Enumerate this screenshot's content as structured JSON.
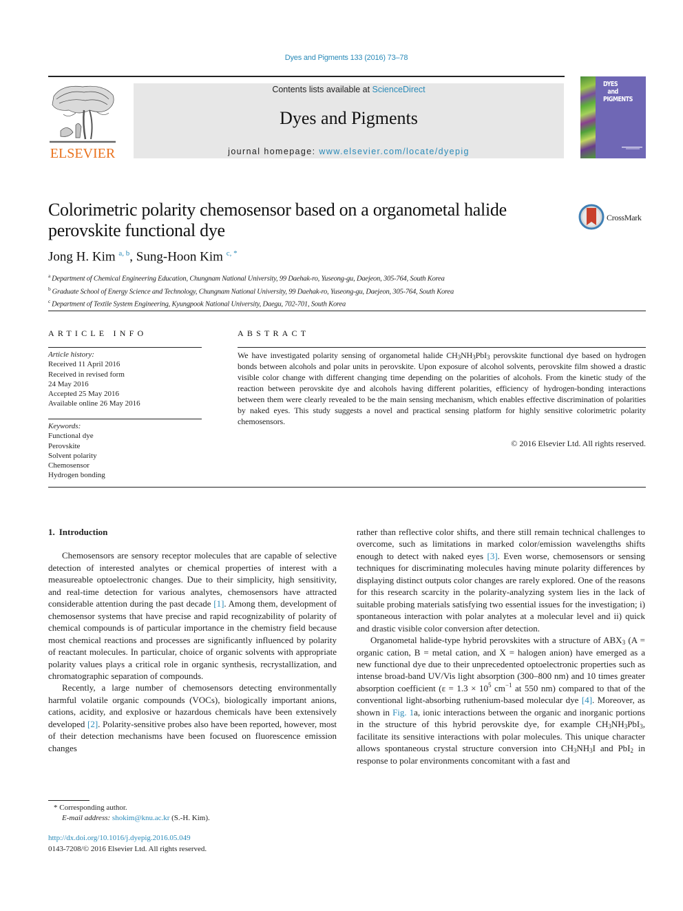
{
  "header": {
    "citation": "Dyes and Pigments 133 (2016) 73–78",
    "contents_prefix": "Contents lists available at ",
    "contents_link": "ScienceDirect",
    "journal_name": "Dyes and Pigments",
    "homepage_prefix": "journal homepage: ",
    "homepage_link": "www.elsevier.com/locate/dyepig",
    "publisher_logo_text": "ELSEVIER",
    "cover_title_lines": [
      "DYES",
      "and",
      "PIGMENTS"
    ],
    "colors": {
      "link": "#2a8ab8",
      "publisher_orange": "#e9711c",
      "banner_gray": "#e7e7e7",
      "cover_purple": "#6f67b5"
    }
  },
  "article": {
    "title_line1": "Colorimetric polarity chemosensor based on a organometal halide",
    "title_line2": "perovskite functional dye",
    "crossmark_label": "CrossMark",
    "authors": [
      {
        "name": "Jong H. Kim",
        "affil_marks": "a, b"
      },
      {
        "name": "Sung-Hoon Kim",
        "affil_marks": "c, *"
      }
    ],
    "author_separator": ", ",
    "affiliations": [
      {
        "mark": "a",
        "text": "Department of Chemical Engineering Education, Chungnam National University, 99 Daehak-ro, Yuseong-gu, Daejeon, 305-764, South Korea"
      },
      {
        "mark": "b",
        "text": "Graduate School of Energy Science and Technology, Chungnam National University, 99 Daehak-ro, Yuseong-gu, Daejeon, 305-764, South Korea"
      },
      {
        "mark": "c",
        "text": "Department of Textile System Engineering, Kyungpook National University, Daegu, 702-701, South Korea"
      }
    ]
  },
  "article_info": {
    "heading": "ARTICLE INFO",
    "history_label": "Article history:",
    "history": [
      "Received 11 April 2016",
      "Received in revised form",
      "24 May 2016",
      "Accepted 25 May 2016",
      "Available online 26 May 2016"
    ],
    "keywords_label": "Keywords:",
    "keywords": [
      "Functional dye",
      "Perovskite",
      "Solvent polarity",
      "Chemosensor",
      "Hydrogen bonding"
    ]
  },
  "abstract": {
    "heading": "ABSTRACT",
    "text_part1": "We have investigated polarity sensing of organometal halide ",
    "formula": [
      "CH",
      "3",
      "NH",
      "3",
      "PbI",
      "3"
    ],
    "text_part2": " perovskite functional dye based on hydrogen bonds between alcohols and polar units in perovskite. Upon exposure of alcohol solvents, perovskite film showed a drastic visible color change with different changing time depending on the polarities of alcohols. From the kinetic study of the reaction between perovskite dye and alcohols having different polarities, efficiency of hydrogen-bonding interactions between them were clearly revealed to be the main sensing mechanism, which enables effective discrimination of polarities by naked eyes. This study suggests a novel and practical sensing platform for highly sensitive colorimetric polarity chemosensors.",
    "copyright": "© 2016 Elsevier Ltd. All rights reserved."
  },
  "body": {
    "section_number": "1.",
    "section_title": "Introduction",
    "left_p1_a": "Chemosensors are sensory receptor molecules that are capable of selective detection of interested analytes or chemical properties of interest with a measureable optoelectronic changes. Due to their simplicity, high sensitivity, and real-time detection for various analytes, chemosensors have attracted considerable attention during the past decade ",
    "ref1": "[1]",
    "left_p1_b": ". Among them, development of chemosensor systems that have precise and rapid recognizability of polarity of chemical compounds is of particular importance in the chemistry field because most chemical reactions and processes are significantly influenced by polarity of reactant molecules. In particular, choice of organic solvents with appropriate polarity values plays a critical role in organic synthesis, recrystallization, and chromatographic separation of compounds.",
    "left_p2_a": "Recently, a large number of chemosensors detecting environmentally harmful volatile organic compounds (VOCs), biologically important anions, cations, acidity, and explosive or hazardous chemicals have been extensively developed ",
    "ref2": "[2]",
    "left_p2_b": ". Polarity-sensitive probes also have been reported, however, most of their detection mechanisms have been focused on fluorescence emission changes",
    "right_p1_a": "rather than reflective color shifts, and there still remain technical challenges to overcome, such as limitations in marked color/emission wavelengths shifts enough to detect with naked eyes ",
    "ref3": "[3]",
    "right_p1_b": ". Even worse, chemosensors or sensing techniques for discriminating molecules having minute polarity differences by displaying distinct outputs color changes are rarely explored. One of the reasons for this research scarcity in the polarity-analyzing system lies in the lack of suitable probing materials satisfying two essential issues for the investigation; i) spontaneous interaction with polar analytes at a molecular level and ii) quick and drastic visible color conversion after detection.",
    "right_p2_a": "Organometal halide-type hybrid perovskites with a structure of ABX",
    "right_p2_b": " (A = organic cation, B = metal cation, and X = halogen anion) have emerged as a new functional dye due to their unprecedented optoelectronic properties such as intense broad-band UV/Vis light absorption (300–800 nm) and 10 times greater absorption coefficient (ε = 1.3 × 10",
    "exp5": "5",
    "right_p2_c": " cm",
    "exp_neg1": "−1",
    "right_p2_d": " at 550 nm) compared to that of the conventional light-absorbing ruthenium-based molecular dye ",
    "ref4": "[4]",
    "right_p2_e": ". Moreover, as shown in ",
    "fig_ref": "Fig. 1",
    "right_p2_f": "a, ionic interactions between the organic and inorganic portions in the structure of this hybrid perovskite dye, for example CH",
    "right_p2_g": "NH",
    "right_p2_h": "PbI",
    "right_p2_i": ", facilitate its sensitive interactions with polar molecules. This unique character allows spontaneous crystal structure conversion into CH",
    "right_p2_j": "NH",
    "right_p2_k": "I and PbI",
    "right_p2_l": " in response to polar environments concomitant with a fast and",
    "sub3": "3",
    "sub2": "2"
  },
  "footer": {
    "corresponding_mark": "*",
    "corresponding_text": " Corresponding author.",
    "email_label": "E-mail address:",
    "email": "shokim@knu.ac.kr",
    "email_suffix": " (S.-H. Kim).",
    "doi": "http://dx.doi.org/10.1016/j.dyepig.2016.05.049",
    "issn_line": "0143-7208/© 2016 Elsevier Ltd. All rights reserved."
  }
}
